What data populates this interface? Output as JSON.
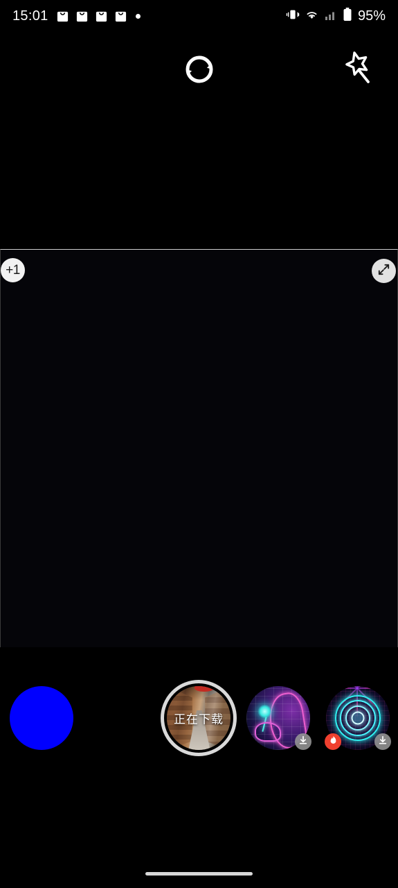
{
  "status_bar": {
    "clock": "15:01",
    "notification_icons": [
      "shopping-bag-icon",
      "shopping-bag-icon",
      "shopping-bag-icon",
      "shopping-bag-icon",
      "dot-icon"
    ],
    "vibrate_icon": "vibrate-icon",
    "wifi_icon": "wifi-icon",
    "cellular_icon": "cellular-signal-icon",
    "battery_icon": "battery-icon",
    "battery_percent": "95%"
  },
  "toolbar": {
    "rotate_label": "rotate-icon",
    "magic_label": "magic-wand-icon"
  },
  "preview": {
    "overlay_count_badge": "+1",
    "expand_label": "expand-icon",
    "background_color": "#050509"
  },
  "thumbnails": {
    "items": [
      {
        "name": "solid-color-swatch",
        "kind": "color",
        "color": "#0000ff",
        "caption": "",
        "selected": false,
        "badges": []
      },
      {
        "name": "alley-photo",
        "kind": "photo",
        "caption": "正在下载",
        "selected": true,
        "badges": []
      },
      {
        "name": "neon-girl-art",
        "kind": "photo",
        "caption": "",
        "selected": false,
        "badges": [
          "download-icon"
        ]
      },
      {
        "name": "neon-mandala-art",
        "kind": "photo",
        "caption": "",
        "selected": false,
        "badges": [
          "flame-icon",
          "download-icon"
        ]
      }
    ]
  },
  "navigation": {
    "gesture_pill": "home-gesture-pill"
  },
  "colors": {
    "accent_blue": "#0000ff",
    "hot_badge": "#f0402f",
    "download_badge": "#969696",
    "selection_ring": "#d9d9d9"
  }
}
